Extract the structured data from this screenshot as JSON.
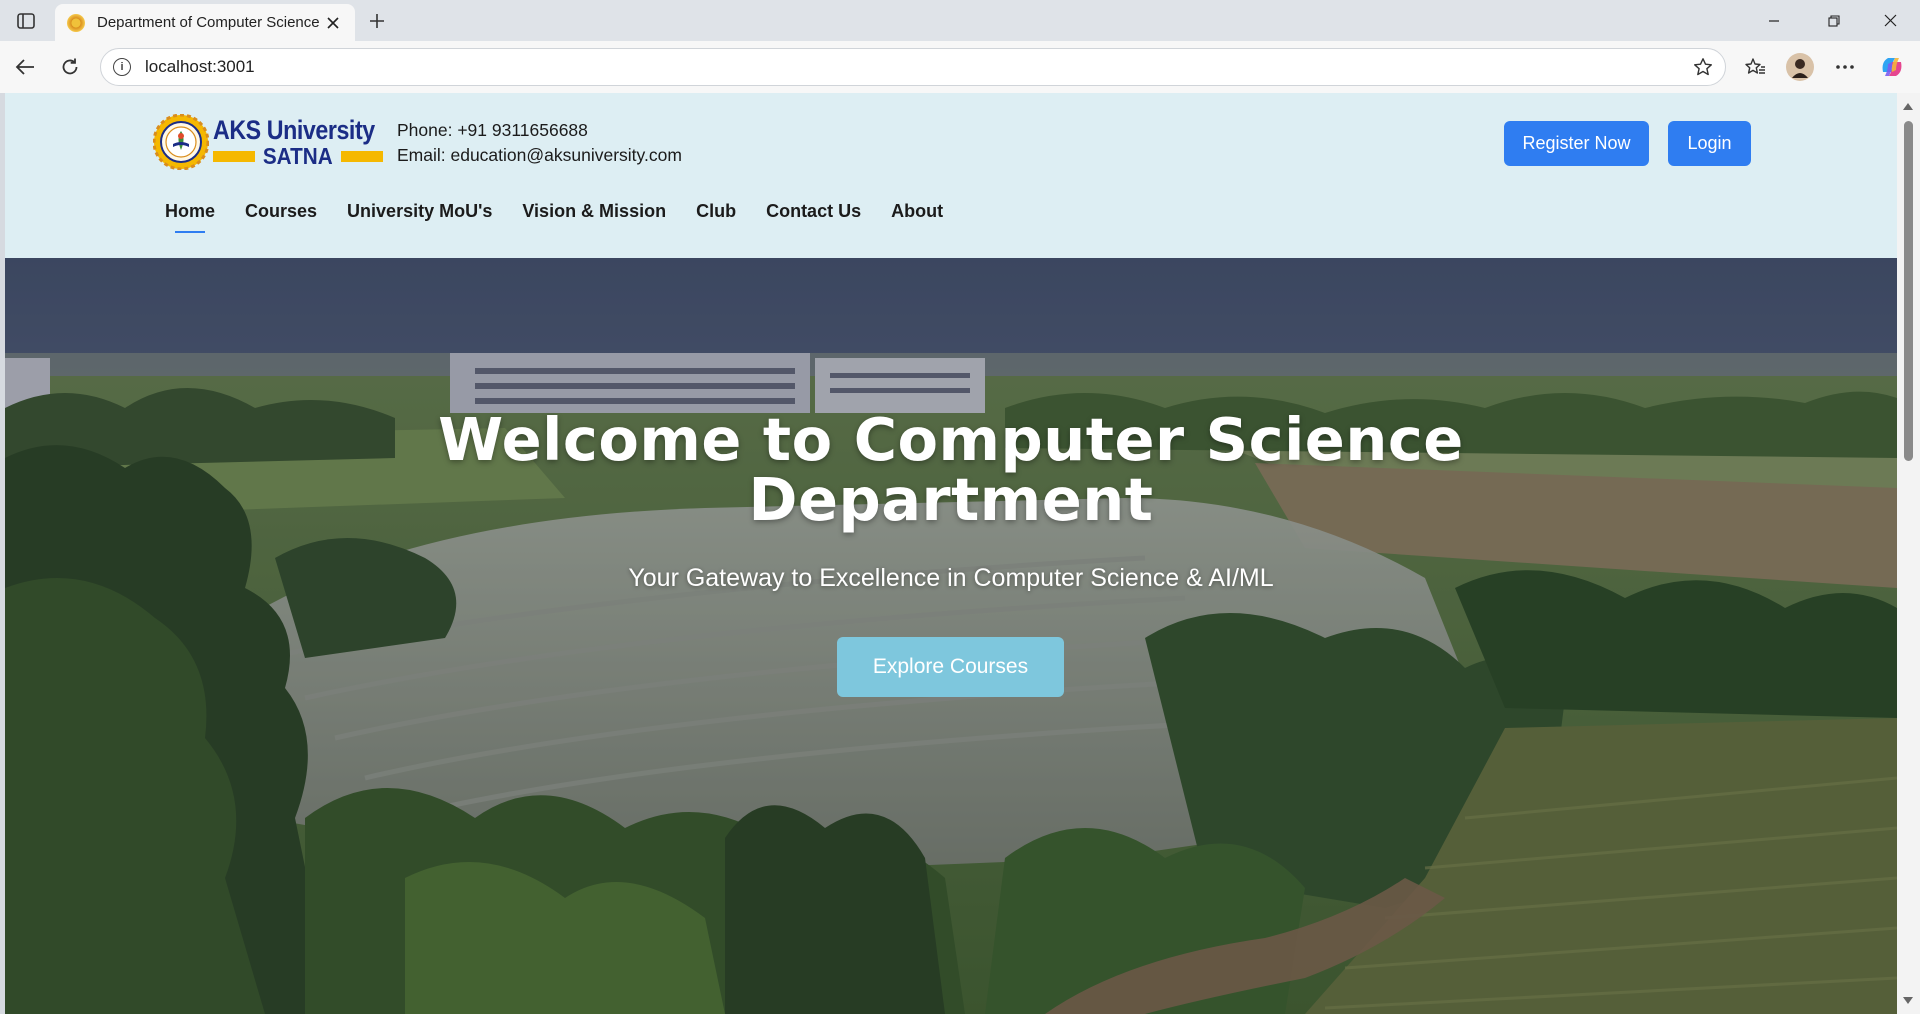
{
  "browser": {
    "tab_title": "Department of Computer Science",
    "url": "localhost:3001",
    "icons": [
      "sidebar-toggle-icon",
      "close-icon",
      "plus-icon",
      "minimize-icon",
      "restore-icon",
      "back-icon",
      "refresh-icon",
      "info-icon",
      "star-icon",
      "favorites-icon",
      "profile-icon",
      "more-icon",
      "copilot-icon"
    ]
  },
  "header": {
    "logo": {
      "line1": "AKS University",
      "line2": "SATNA"
    },
    "contact": {
      "phone": "Phone: +91 9311656688",
      "email": "Email: education@aksuniversity.com"
    },
    "register_label": "Register Now",
    "login_label": "Login"
  },
  "nav": {
    "items": [
      {
        "label": "Home",
        "active": true
      },
      {
        "label": "Courses"
      },
      {
        "label": "University MoU's"
      },
      {
        "label": "Vision & Mission"
      },
      {
        "label": "Club"
      },
      {
        "label": "Contact Us"
      },
      {
        "label": "About"
      }
    ]
  },
  "hero": {
    "title_line1": "Welcome to Computer Science",
    "title_line2": "Department",
    "subtitle": "Your Gateway to Excellence in Computer Science & AI/ML",
    "cta_label": "Explore Courses"
  },
  "colors": {
    "header_bg": "#ddeef3",
    "primary_button": "#2f7df1",
    "cta_button": "#7ec7dd",
    "logo_blue": "#1b2d86",
    "logo_yellow": "#f5b800"
  }
}
